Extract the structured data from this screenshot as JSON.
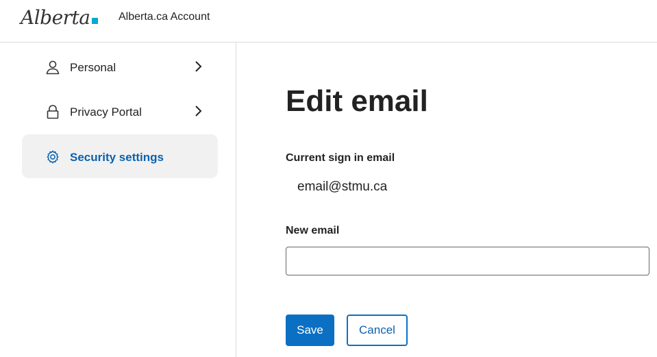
{
  "header": {
    "logo_text": "Alberta",
    "app_title": "Alberta.ca Account"
  },
  "sidebar": {
    "items": [
      {
        "label": "Personal",
        "icon": "user-icon",
        "has_chevron": true,
        "active": false
      },
      {
        "label": "Privacy Portal",
        "icon": "lock-icon",
        "has_chevron": true,
        "active": false
      },
      {
        "label": "Security settings",
        "icon": "gear-icon",
        "has_chevron": false,
        "active": true
      }
    ]
  },
  "main": {
    "title": "Edit email",
    "current_email_label": "Current sign in email",
    "current_email_value": "email@stmu.ca",
    "new_email_label": "New email",
    "new_email_value": "",
    "new_email_placeholder": ""
  },
  "actions": {
    "save_label": "Save",
    "cancel_label": "Cancel"
  },
  "colors": {
    "primary": "#0b70c4",
    "active_text": "#0b61ad",
    "active_bg": "#f1f1f1",
    "logo_accent": "#00aad2"
  }
}
